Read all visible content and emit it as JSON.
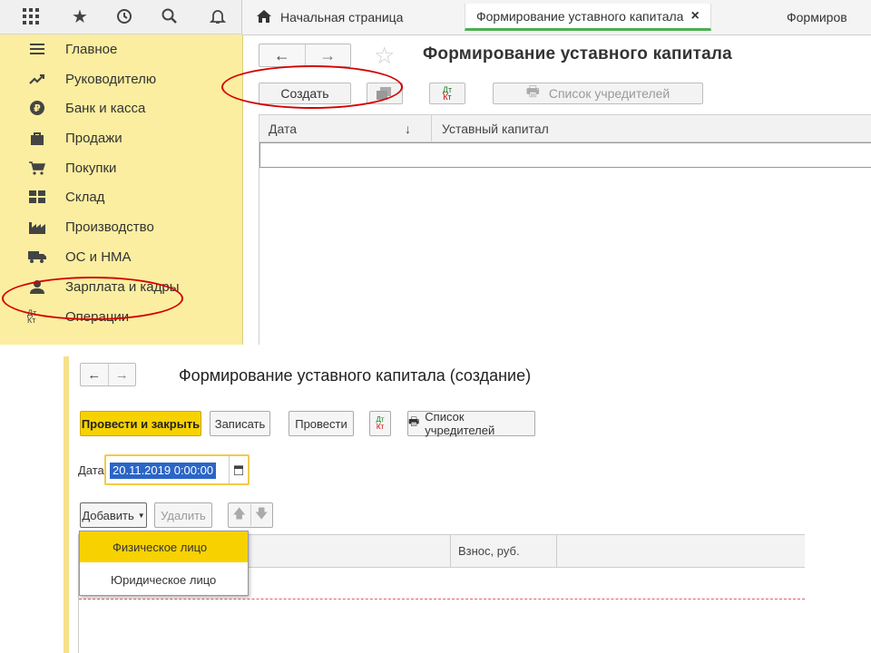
{
  "top": {
    "toolbar_icons": [
      "grid-icon",
      "star-icon",
      "history-icon",
      "search-icon",
      "bell-icon"
    ],
    "tabs": [
      {
        "label": "Начальная страница",
        "icon": "home-icon"
      },
      {
        "label": "Формирование уставного капитала",
        "close": "×"
      },
      {
        "label": "Формиров"
      }
    ],
    "sidebar": [
      {
        "label": "Главное",
        "icon": "menu-icon"
      },
      {
        "label": "Руководителю",
        "icon": "trend-icon"
      },
      {
        "label": "Банк и касса",
        "icon": "ruble-icon"
      },
      {
        "label": "Продажи",
        "icon": "bag-icon"
      },
      {
        "label": "Покупки",
        "icon": "cart-icon"
      },
      {
        "label": "Склад",
        "icon": "warehouse-icon"
      },
      {
        "label": "Производство",
        "icon": "factory-icon"
      },
      {
        "label": "ОС и НМА",
        "icon": "truck-icon"
      },
      {
        "label": "Зарплата и кадры",
        "icon": "person-icon"
      },
      {
        "label": "Операции",
        "icon": "dt-kt-icon"
      }
    ],
    "main": {
      "title": "Формирование уставного капитала",
      "create_label": "Создать",
      "dtkt_top": "Дт",
      "dtkt_bottom": "Кт",
      "founders_label": "Список учредителей",
      "columns": [
        {
          "label": "Дата",
          "sort": "↓"
        },
        {
          "label": "Уставный капитал"
        }
      ]
    }
  },
  "bottom": {
    "title": "Формирование уставного капитала (создание)",
    "buttons": {
      "post_close": "Провести и закрыть",
      "save": "Записать",
      "post": "Провести",
      "dtkt_top": "Дт",
      "dtkt_bottom": "Кт",
      "founders": "Список учредителей"
    },
    "date_label": "Дата:",
    "date_value": "20.11.2019  0:00:00",
    "add_label": "Добавить",
    "delete_label": "Удалить",
    "columns": [
      {
        "label": ""
      },
      {
        "label": "Взнос, руб."
      }
    ],
    "dropdown": [
      {
        "label": "Физическое лицо",
        "highlighted": true
      },
      {
        "label": "Юридическое лицо",
        "highlighted": false
      }
    ]
  },
  "colors": {
    "sidebar_bg": "#fbeea0",
    "accent_yellow": "#f7d200",
    "annotation_red": "#d40000",
    "selection_blue": "#2b65c6"
  }
}
